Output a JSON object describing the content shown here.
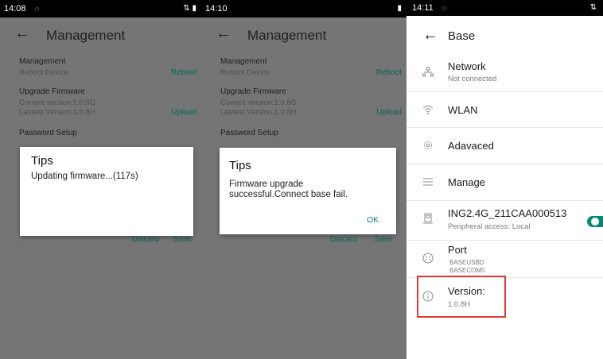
{
  "panel1": {
    "time": "14:08",
    "appbar_title": "Management",
    "section_management": "Management",
    "reboot_device": "Reboot Device",
    "reboot_action": "Reboot",
    "upgrade_firmware": "Upgrade Firmware",
    "current_version": "Current version:1.0.8G",
    "latest_version": "Lastest Version:1.0.8H",
    "upload_action": "Upload",
    "password_setup": "Password Setup",
    "dialog_title": "Tips",
    "dialog_message": "Updating firmware...(117s)",
    "discard": "Discard",
    "save": "Save"
  },
  "panel2": {
    "time": "14:10",
    "appbar_title": "Management",
    "section_management": "Management",
    "reboot_device": "Reboot Device",
    "reboot_action": "Reboot",
    "upgrade_firmware": "Upgrade Firmware",
    "current_version": "Current version:1.0.8G",
    "latest_version": "Lastest Version:1.0.8H",
    "upload_action": "Upload",
    "password_setup": "Password Setup",
    "dialog_title": "Tips",
    "dialog_line1": "Firmware upgrade",
    "dialog_line2": "successful.Connect base fail.",
    "ok": "OK",
    "discard": "Discard",
    "save": "Save"
  },
  "panel3": {
    "time": "14:11",
    "appbar_title": "Base",
    "items": [
      {
        "title": "Network",
        "sub": "Not connected",
        "icon": "network-icon"
      },
      {
        "title": "WLAN",
        "icon": "wifi-icon"
      },
      {
        "title": "Adavaced",
        "icon": "gear-icon"
      },
      {
        "title": "Manage",
        "icon": "menu-icon"
      },
      {
        "title": "ING2.4G_211CAA000513",
        "sub": "Peripheral access: Local",
        "icon": "device-icon"
      },
      {
        "title": "Port",
        "sub1": "BASEUSBD",
        "sub2": "BASECOM0",
        "icon": "port-icon"
      },
      {
        "title": "Version:",
        "sub": "1.0.8H",
        "icon": "info-icon"
      }
    ]
  },
  "colors": {
    "accent": "#00897b",
    "highlight": "#e53935",
    "dim": "#757575"
  }
}
